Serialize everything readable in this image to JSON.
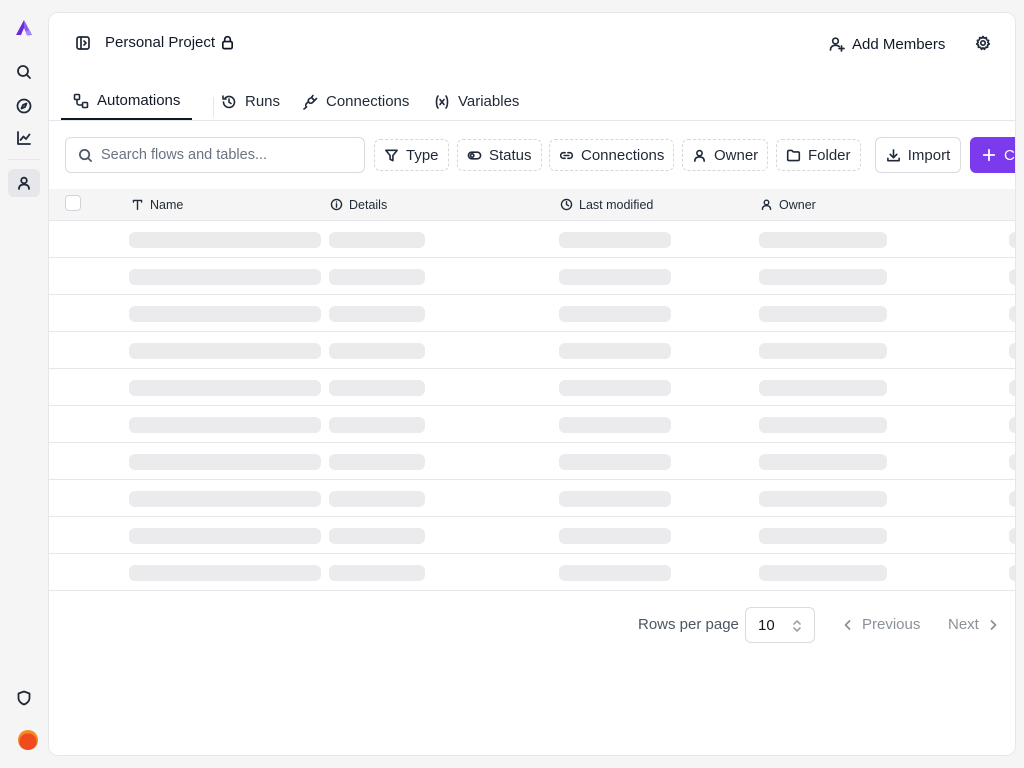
{
  "app": {
    "accent_color": "#7c3aed",
    "logo_icon": "brand-logo-icon"
  },
  "rail": {
    "items": [
      {
        "icon": "search-icon"
      },
      {
        "icon": "compass-icon"
      },
      {
        "icon": "chart-icon"
      },
      {
        "icon": "user-icon",
        "active": true
      }
    ],
    "bottom": [
      {
        "icon": "shield-icon"
      },
      {
        "icon": "avatar"
      }
    ]
  },
  "header": {
    "project_title": "Personal Project",
    "add_members_label": "Add Members"
  },
  "tabs": [
    {
      "label": "Automations",
      "active": true
    },
    {
      "label": "Runs"
    },
    {
      "label": "Connections"
    },
    {
      "label": "Variables"
    }
  ],
  "toolbar": {
    "search_placeholder": "Search flows and tables...",
    "filters": [
      "Type",
      "Status",
      "Connections",
      "Owner",
      "Folder"
    ],
    "import_label": "Import",
    "create_label": "Cr"
  },
  "table": {
    "columns": [
      "Name",
      "Details",
      "Last modified",
      "Owner"
    ],
    "loading_rows": 10
  },
  "pagination": {
    "rows_per_page_label": "Rows per page",
    "rows_per_page_value": "10",
    "previous_label": "Previous",
    "next_label": "Next"
  }
}
